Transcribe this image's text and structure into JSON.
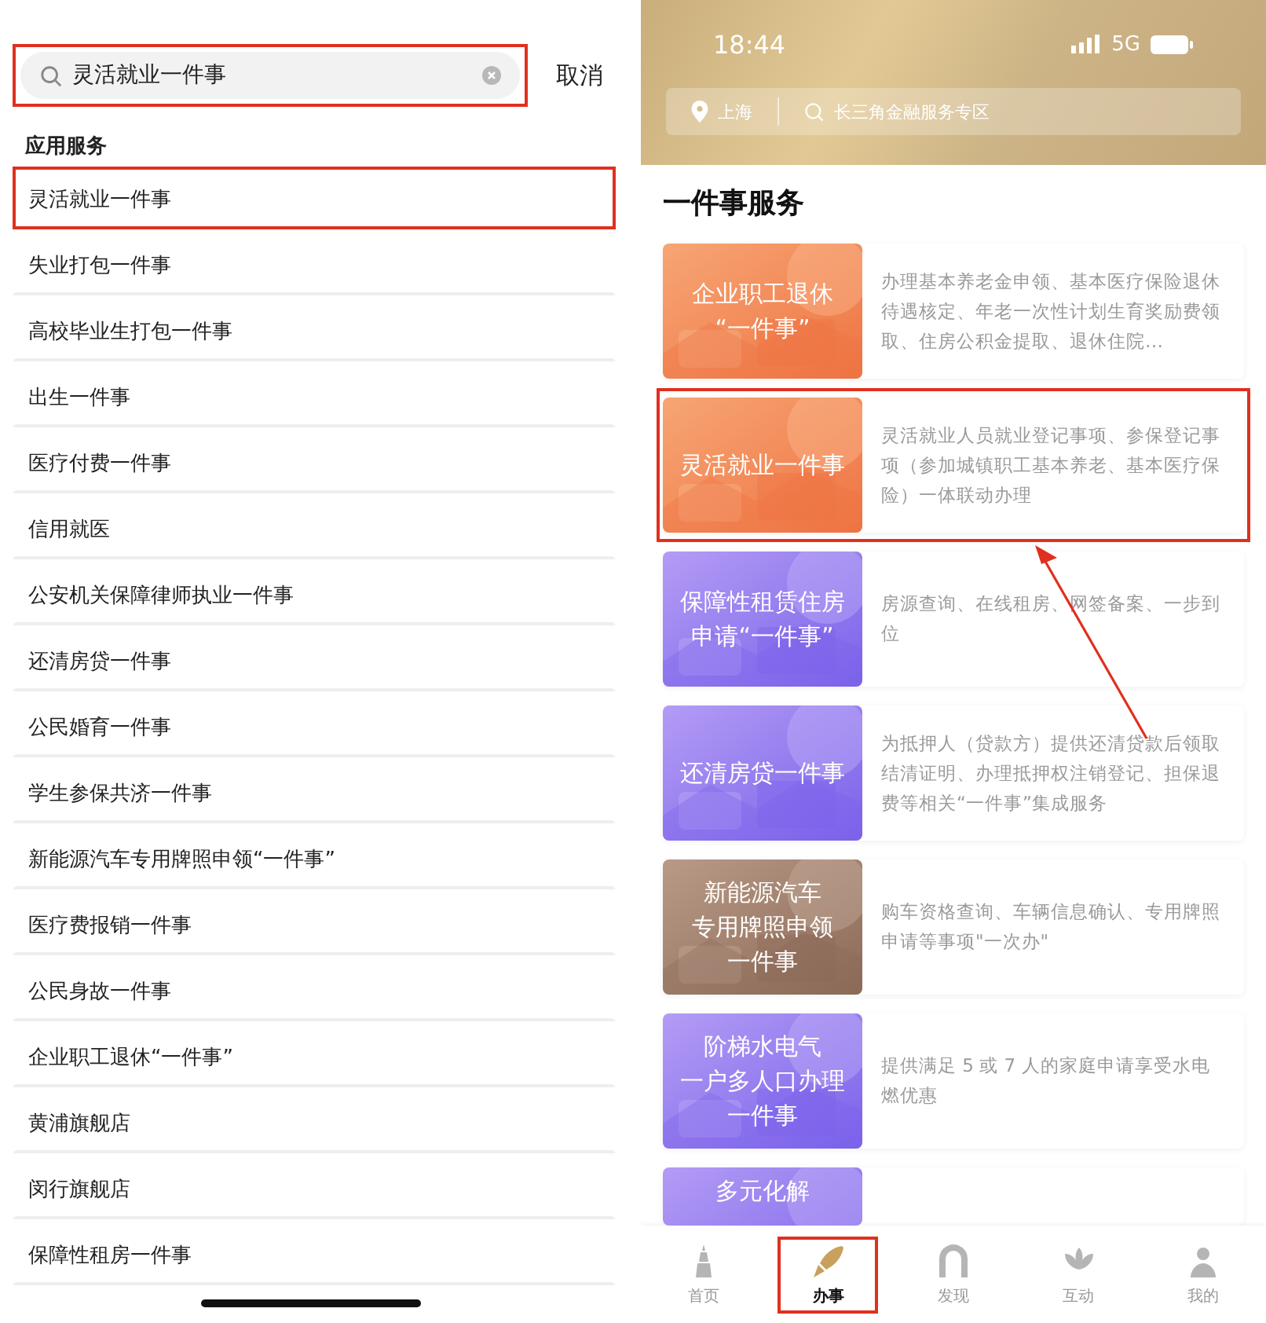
{
  "search_page": {
    "search": {
      "value": "灵活就业一件事",
      "highlighted": true
    },
    "cancel": "取消",
    "section_title": "应用服务",
    "results": [
      {
        "label": "灵活就业一件事",
        "highlighted": true
      },
      {
        "label": "失业打包一件事",
        "highlighted": false
      },
      {
        "label": "高校毕业生打包一件事",
        "highlighted": false
      },
      {
        "label": "出生一件事",
        "highlighted": false
      },
      {
        "label": "医疗付费一件事",
        "highlighted": false
      },
      {
        "label": "信用就医",
        "highlighted": false
      },
      {
        "label": "公安机关保障律师执业一件事",
        "highlighted": false
      },
      {
        "label": "还清房贷一件事",
        "highlighted": false
      },
      {
        "label": "公民婚育一件事",
        "highlighted": false
      },
      {
        "label": "学生参保共济一件事",
        "highlighted": false
      },
      {
        "label": "新能源汽车专用牌照申领“一件事”",
        "highlighted": false
      },
      {
        "label": "医疗费报销一件事",
        "highlighted": false
      },
      {
        "label": "公民身故一件事",
        "highlighted": false
      },
      {
        "label": "企业职工退休“一件事”",
        "highlighted": false
      },
      {
        "label": "黄浦旗舰店",
        "highlighted": false
      },
      {
        "label": "闵行旗舰店",
        "highlighted": false
      },
      {
        "label": "保障性租房一件事",
        "highlighted": false
      }
    ]
  },
  "service_page": {
    "status_bar": {
      "time": "18:44",
      "network": "5G"
    },
    "location": "上海",
    "search": {
      "placeholder": "长三角金融服务专区"
    },
    "title": "一件事服务",
    "cards": [
      {
        "kind": "orange",
        "title_lines": [
          "企业职工退休",
          "“一件事”"
        ],
        "description": "办理基本养老金申领、基本医疗保险退休待遇核定、年老一次性计划生育奖励费领取、住房公积金提取、退休住院…",
        "highlighted": false
      },
      {
        "kind": "orange",
        "title_lines": [
          "灵活就业一件事"
        ],
        "description": "灵活就业人员就业登记事项、参保登记事项（参加城镇职工基本养老、基本医疗保险）一体联动办理",
        "highlighted": true
      },
      {
        "kind": "purple",
        "title_lines": [
          "保障性租赁住房",
          "申请“一件事”"
        ],
        "description": "房源查询、在线租房、网签备案、一步到位",
        "highlighted": false
      },
      {
        "kind": "purple",
        "title_lines": [
          "还清房贷一件事"
        ],
        "description": "为抵押人（贷款方）提供还清贷款后领取结清证明、办理抵押权注销登记、担保退费等相关“一件事”集成服务",
        "highlighted": false
      },
      {
        "kind": "brown",
        "title_lines": [
          "新能源汽车",
          "专用牌照申领",
          "一件事"
        ],
        "description": "购车资格查询、车辆信息确认、专用牌照申请等事项\"一次办\"",
        "highlighted": false
      },
      {
        "kind": "purple",
        "title_lines": [
          "阶梯水电气",
          "一户多人口办理",
          "一件事"
        ],
        "description": "提供满足 5 或 7 人的家庭申请享受水电燃优惠",
        "highlighted": false
      },
      {
        "kind": "purple",
        "title_lines": [
          "多元化解"
        ],
        "highlighted": false
      }
    ],
    "tabs": [
      {
        "label": "首页",
        "selected": false,
        "highlighted": false
      },
      {
        "label": "办事",
        "selected": true,
        "highlighted": true
      },
      {
        "label": "发现",
        "selected": false,
        "highlighted": false
      },
      {
        "label": "互动",
        "selected": false,
        "highlighted": false
      },
      {
        "label": "我的",
        "selected": false,
        "highlighted": false
      }
    ]
  }
}
